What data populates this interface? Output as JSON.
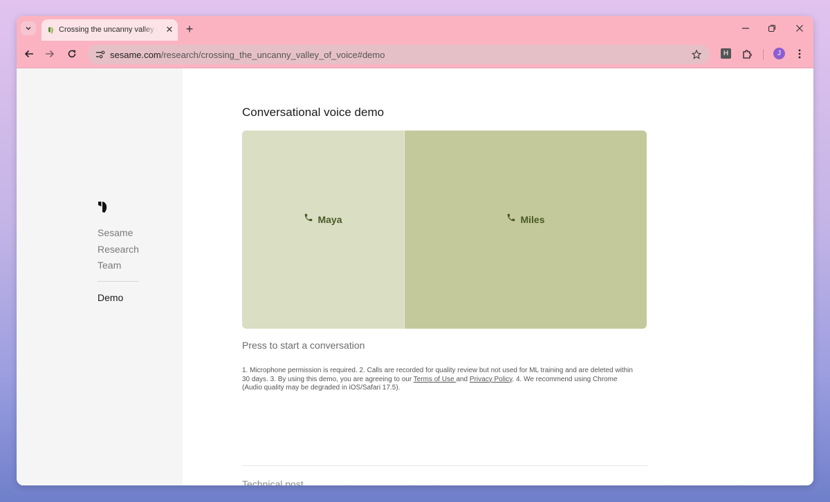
{
  "browser": {
    "tab_title": "Crossing the uncanny valley of voice",
    "url_host": "sesame.com",
    "url_path": "/research/crossing_the_uncanny_valley_of_voice#demo",
    "profile_initial": "J",
    "extension_letter": "H"
  },
  "sidebar": {
    "items": [
      {
        "label": "Sesame"
      },
      {
        "label": "Research"
      },
      {
        "label": "Team"
      }
    ],
    "active_item": "Demo"
  },
  "main": {
    "heading": "Conversational voice demo",
    "voices": [
      {
        "name": "Maya",
        "color": "#dadec3"
      },
      {
        "name": "Miles",
        "color": "#c3c99b"
      }
    ],
    "prompt": "Press to start a conversation",
    "notes": {
      "part1": "1. Microphone permission is required. 2. Calls are recorded for quality review but not used for ML training and are deleted within 30 days. 3. By using this demo, you are agreeing to our ",
      "terms_link": "Terms of Use ",
      "and": "and ",
      "privacy_link": "Privacy Policy",
      "part2": ". 4. We recommend using Chrome (Audio quality may be degraded in iOS/Safari 17.5)."
    },
    "next_section": "Technical post"
  },
  "colors": {
    "titlebar": "#fbb3c2",
    "accent_text": "#4a5a26"
  }
}
